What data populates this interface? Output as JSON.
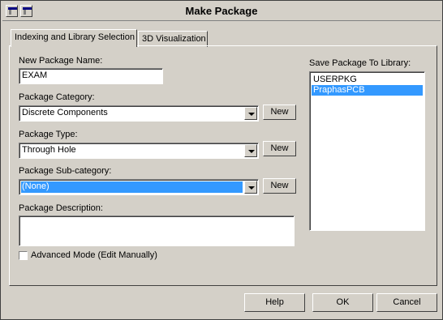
{
  "window": {
    "title": "Make Package"
  },
  "tabs": [
    {
      "label": "Indexing and Library Selection",
      "active": true
    },
    {
      "label": "3D Visualization",
      "active": false
    }
  ],
  "form": {
    "name_label": "New Package Name:",
    "name_value": "EXAM",
    "category_label": "Package Category:",
    "category_value": "Discrete Components",
    "type_label": "Package Type:",
    "type_value": "Through Hole",
    "subcategory_label": "Package Sub-category:",
    "subcategory_value": "(None)",
    "description_label": "Package Description:",
    "description_value": "",
    "new_label": "New",
    "advanced_label": "Advanced Mode (Edit Manually)",
    "advanced_checked": false
  },
  "library": {
    "label": "Save Package To Library:",
    "items": [
      {
        "label": "USERPKG",
        "selected": false
      },
      {
        "label": "PraphasPCB",
        "selected": true
      }
    ]
  },
  "buttons": {
    "help": "Help",
    "ok": "OK",
    "cancel": "Cancel"
  },
  "colors": {
    "face": "#d4d0c8",
    "selection": "#3399ff"
  }
}
